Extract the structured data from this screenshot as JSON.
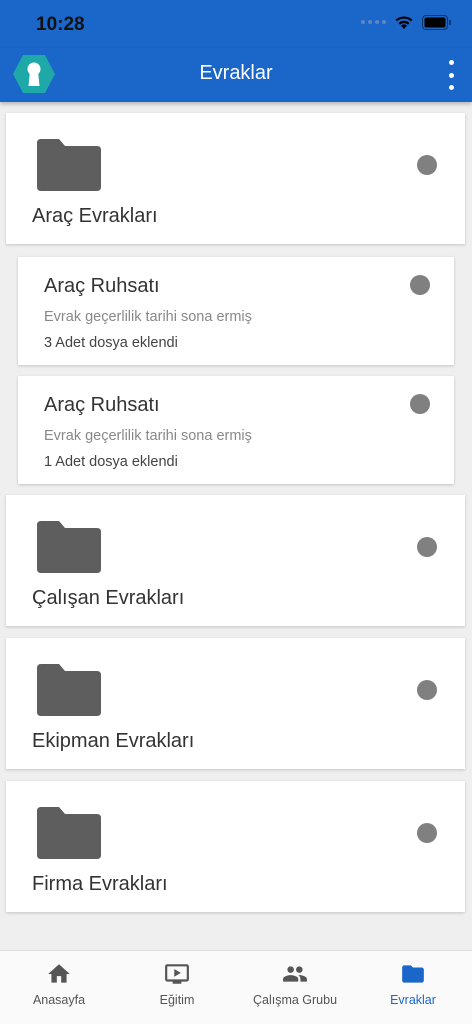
{
  "status_bar": {
    "time": "10:28"
  },
  "app_bar": {
    "title": "Evraklar",
    "menu_icon": "more-vertical-icon",
    "logo_icon": "keyhole-logo-icon"
  },
  "colors": {
    "primary": "#1a66c9",
    "folder": "#5e5e5e",
    "dot": "#808080",
    "logo": "#1fa8a8"
  },
  "sections": [
    {
      "type": "folder",
      "label": "Araç Evrakları"
    },
    {
      "type": "document",
      "title": "Araç Ruhsatı",
      "status": "Evrak geçerlilik tarihi sona ermiş",
      "count": "3 Adet dosya eklendi"
    },
    {
      "type": "document",
      "title": "Araç Ruhsatı",
      "status": "Evrak geçerlilik tarihi sona ermiş",
      "count": "1 Adet dosya eklendi"
    },
    {
      "type": "folder",
      "label": "Çalışan Evrakları"
    },
    {
      "type": "folder",
      "label": "Ekipman Evrakları"
    },
    {
      "type": "folder",
      "label": "Firma Evrakları"
    }
  ],
  "bottom_nav": [
    {
      "label": "Anasayfa",
      "icon": "home-icon",
      "active": false
    },
    {
      "label": "Eğitim",
      "icon": "video-play-icon",
      "active": false
    },
    {
      "label": "Çalışma Grubu",
      "icon": "people-icon",
      "active": false
    },
    {
      "label": "Evraklar",
      "icon": "folder-icon",
      "active": true
    }
  ]
}
